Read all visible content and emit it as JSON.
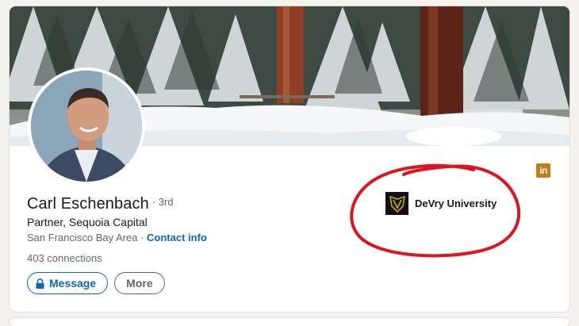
{
  "profile": {
    "name": "Carl Eschenbach",
    "degree": "3rd",
    "headline": "Partner, Sequoia Capital",
    "location": "San Francisco Bay Area",
    "separator": " · ",
    "contact_info": "Contact info",
    "connections": "403 connections"
  },
  "actions": {
    "message_label": "Message",
    "more_label": "More"
  },
  "education": {
    "school_name": "DeVry University"
  },
  "badges": {
    "linkedin_icon_text": "in"
  },
  "colors": {
    "linkedin_blue": "#0a66c2",
    "annotation_red": "#e0141e",
    "linkedin_gold": "#c37d16",
    "devry_gold": "#c9a227"
  },
  "icons": {
    "message_icon": "lock-icon",
    "linkedin_badge": "linkedin-icon",
    "school_logo": "devry-shield-icon"
  }
}
